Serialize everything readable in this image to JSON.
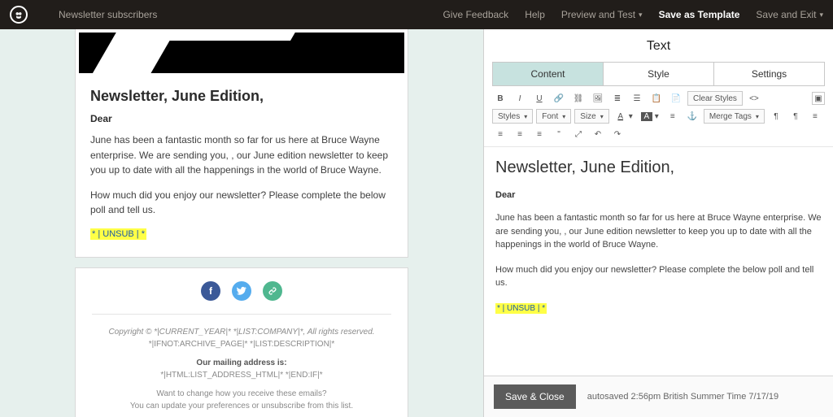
{
  "topbar": {
    "audience": "Newsletter subscribers",
    "give_feedback": "Give Feedback",
    "help": "Help",
    "preview_test": "Preview and Test",
    "save_template": "Save as Template",
    "save_exit": "Save and Exit"
  },
  "preview": {
    "title": "Newsletter, June Edition,",
    "greeting": "Dear",
    "para1": "June has been a fantastic month so far for us here at Bruce Wayne enterprise. We are sending you, , our June edition newsletter to keep you up to date with all the happenings in the world of Bruce Wayne.",
    "para2": "How much did you enjoy our newsletter? Please complete the below poll and tell us.",
    "unsub": "* | UNSUB | *"
  },
  "footer": {
    "copyright": "Copyright © *|CURRENT_YEAR|* *|LIST:COMPANY|*, All rights reserved.",
    "archive": "*|IFNOT:ARCHIVE_PAGE|* *|LIST:DESCRIPTION|*",
    "mailing_label": "Our mailing address is:",
    "mailing_value": "*|HTML:LIST_ADDRESS_HTML|* *|END:IF|*",
    "change": "Want to change how you receive these emails?",
    "update": "You can update your preferences or unsubscribe from this list."
  },
  "panel": {
    "title": "Text",
    "tabs": {
      "content": "Content",
      "style": "Style",
      "settings": "Settings"
    },
    "toolbar": {
      "clear_styles": "Clear Styles",
      "styles": "Styles",
      "font": "Font",
      "size": "Size",
      "merge_tags": "Merge Tags"
    },
    "editor": {
      "title": "Newsletter, June Edition,",
      "greeting": "Dear",
      "para1": "June has been a fantastic month so far for us here at Bruce Wayne enterprise. We are sending you, , our June edition newsletter to keep you up to date with all the happenings in the world of Bruce Wayne.",
      "para2": "How much did you enjoy our newsletter? Please complete the below poll and tell us.",
      "unsub": "* | UNSUB | *"
    },
    "save_close": "Save & Close",
    "autosaved": "autosaved 2:56pm British Summer Time 7/17/19"
  }
}
